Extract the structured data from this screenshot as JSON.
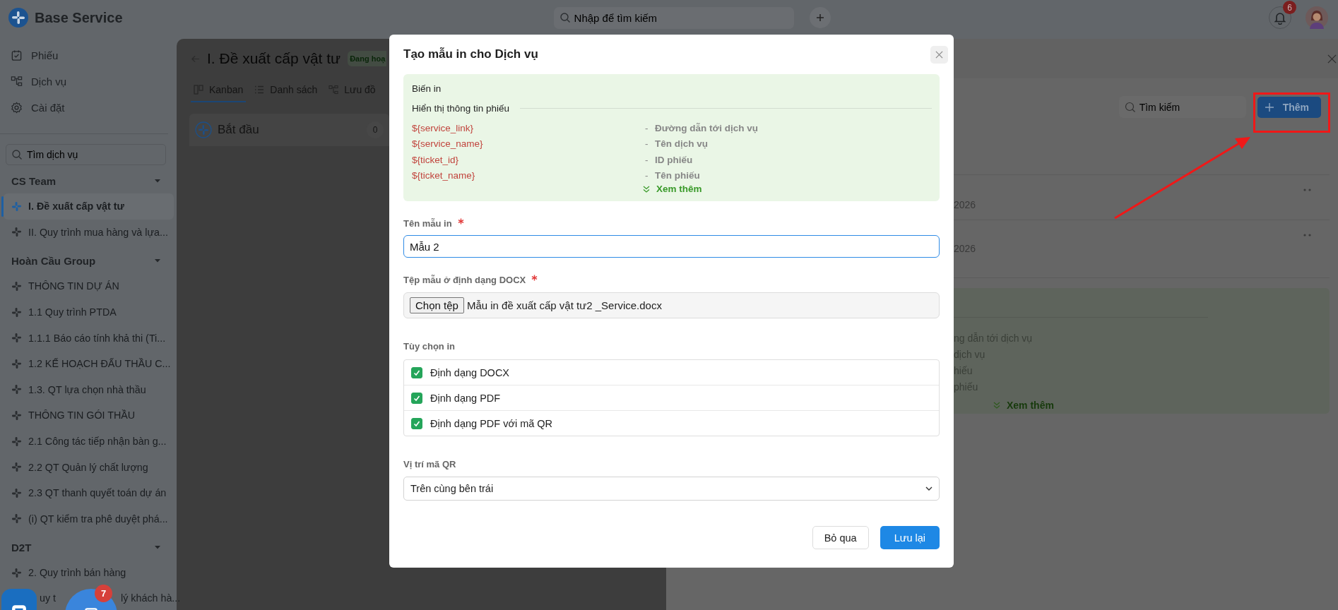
{
  "app": {
    "name": "Base Service"
  },
  "topbar": {
    "search_placeholder": "Nhập để tìm kiếm",
    "notification_count": "6"
  },
  "nav": [
    {
      "label": "Phiếu"
    },
    {
      "label": "Dịch vụ"
    },
    {
      "label": "Cài đặt"
    }
  ],
  "service_search": {
    "placeholder": "Tìm dịch vụ"
  },
  "groups": [
    {
      "name": "CS Team",
      "expanded": true,
      "items": [
        {
          "label": "I. Đề xuất cấp vật tư",
          "selected": true
        },
        {
          "label": "II. Quy trình mua hàng và lựa...",
          "selected": false
        }
      ]
    },
    {
      "name": "Hoàn Cầu Group",
      "expanded": true,
      "items": [
        {
          "label": "THÔNG TIN DỰ ÁN",
          "selected": false
        },
        {
          "label": "1.1 Quy trình PTDA",
          "selected": false
        },
        {
          "label": "1.1.1 Báo cáo tính khả thi (Ti...",
          "selected": false
        },
        {
          "label": "1.2 KẾ HOẠCH ĐẤU THẦU C...",
          "selected": false
        },
        {
          "label": "1.3. QT lựa chọn nhà thầu",
          "selected": false
        },
        {
          "label": "THÔNG TIN GÓI THẦU",
          "selected": false
        },
        {
          "label": "2.1 Công tác tiếp nhận bàn g...",
          "selected": false
        },
        {
          "label": "2.2 QT Quản lý chất lượng",
          "selected": false
        },
        {
          "label": "2.3 QT thanh quyết toán dự án",
          "selected": false
        },
        {
          "label": "(i) QT kiểm tra phê duyệt phá...",
          "selected": false
        }
      ]
    },
    {
      "name": "D2T",
      "expanded": true,
      "items": [
        {
          "label": "2. Quy trình bán hàng",
          "selected": false
        },
        {
          "label": "uy t",
          "label_tail": "lý khách hà...",
          "selected": false
        }
      ]
    }
  ],
  "floating": {
    "task_badge": "7"
  },
  "service": {
    "title": "I. Đề xuất cấp vật tư",
    "status": "Đang hoạ",
    "tabs": [
      {
        "label": "Kanban",
        "selected": true
      },
      {
        "label": "Danh sách",
        "selected": false
      },
      {
        "label": "Lưu đồ",
        "selected": false
      }
    ],
    "columns": [
      {
        "name": "Bắt đầu",
        "count": "0"
      }
    ]
  },
  "drawer": {
    "search_placeholder": "Tìm kiếm",
    "add_button": "Thêm",
    "rows": [
      {
        "text": "2026"
      },
      {
        "text": "2026"
      }
    ],
    "variables_preview": {
      "lines": [
        "ng dẫn tới dịch vụ",
        "dịch vụ",
        "hiếu",
        "phiếu"
      ],
      "more": "Xem thêm"
    }
  },
  "dialog": {
    "title": "Tạo mẫu in cho Dịch vụ",
    "variables": {
      "title": "Biến in",
      "section": "Hiển thị thông tin phiếu",
      "items": [
        {
          "name": "${service_link}",
          "desc": "Đường dẫn tới dịch vụ"
        },
        {
          "name": "${service_name}",
          "desc": "Tên dịch vụ"
        },
        {
          "name": "${ticket_id}",
          "desc": "ID phiếu"
        },
        {
          "name": "${ticket_name}",
          "desc": "Tên phiếu"
        }
      ],
      "separator": "-",
      "more": "Xem thêm"
    },
    "name_field": {
      "label": "Tên mẫu in",
      "required": true,
      "value": "Mẫu 2"
    },
    "file_field": {
      "label": "Tệp mẫu ở định dạng DOCX",
      "required": true,
      "button": "Chọn tệp",
      "file": "Mẫu in đề xuất cấp vật tư2 _Service.docx"
    },
    "options": {
      "label": "Tùy chọn in",
      "items": [
        {
          "label": "Định dạng DOCX",
          "checked": true
        },
        {
          "label": "Định dạng PDF",
          "checked": true
        },
        {
          "label": "Định dạng PDF với mã QR",
          "checked": true
        }
      ]
    },
    "qr_position": {
      "label": "Vị trí mã QR",
      "value": "Trên cùng bên trái"
    },
    "buttons": [
      {
        "label": "Bỏ qua",
        "kind": "secondary"
      },
      {
        "label": "Lưu lại",
        "kind": "primary"
      }
    ]
  },
  "annotation": {
    "highlight": true,
    "arrow": true
  }
}
